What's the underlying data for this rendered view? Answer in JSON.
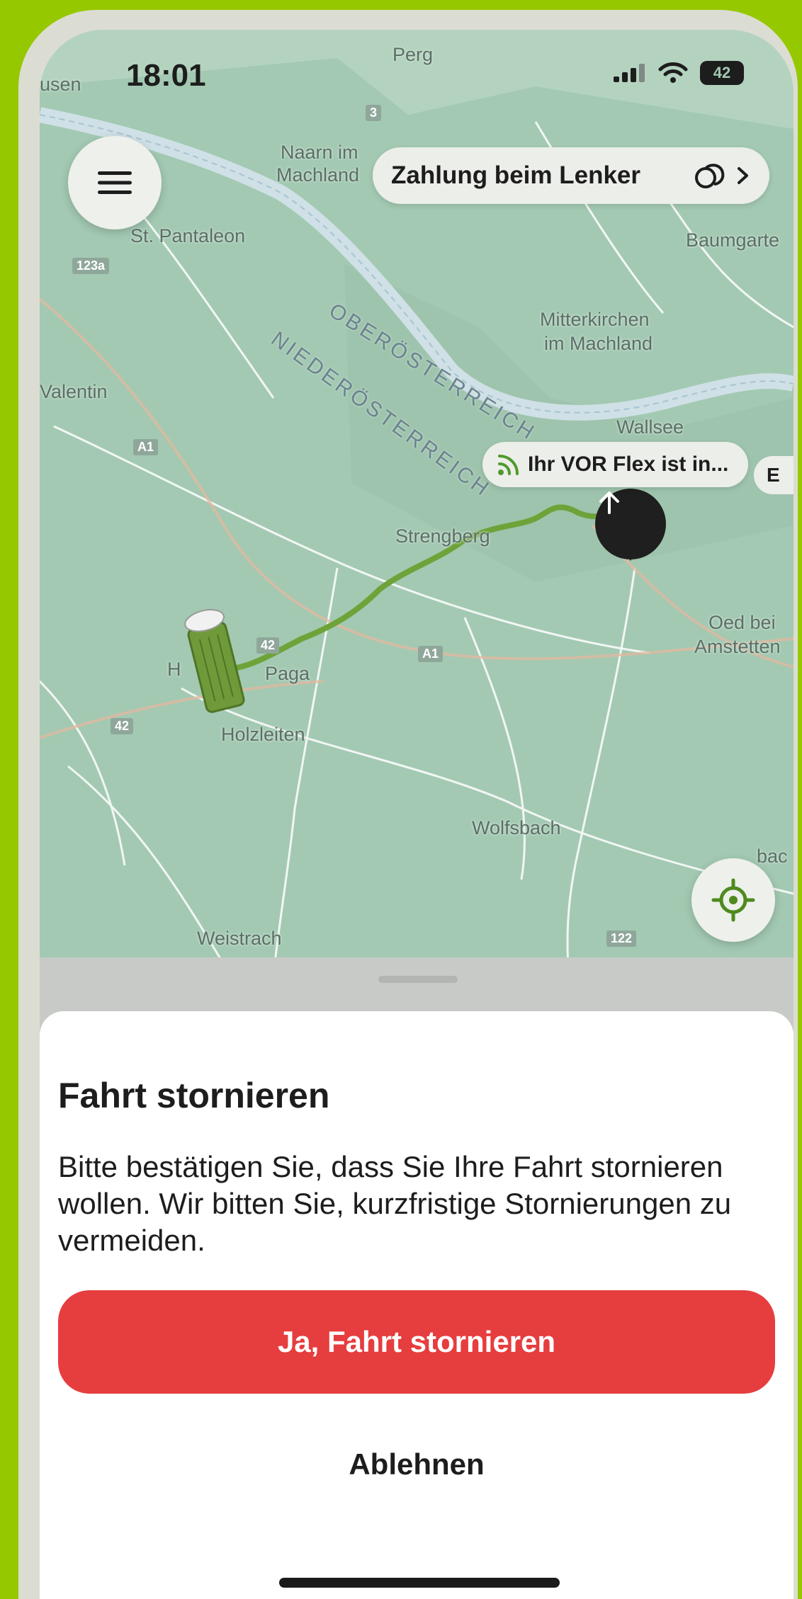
{
  "status_bar": {
    "time": "18:01",
    "battery": "42"
  },
  "map": {
    "places": [
      "Perg",
      "Naarn im",
      "Machland",
      "St. Pantaleon",
      "Baumgarte",
      "Mitterkirchen",
      "im Machland",
      "Valentin",
      "Wallsee",
      "Strengberg",
      "Oed bei",
      "Amstetten",
      "Paga",
      "Holzleiten",
      "Wolfsbach",
      "Weistrach",
      "usen",
      "H",
      "bac"
    ],
    "regions": [
      "OBERÖSTERREICH",
      "NIEDERÖSTERREICH"
    ],
    "road_shields": [
      "3",
      "123a",
      "A1",
      "42",
      "A1",
      "42",
      "122"
    ]
  },
  "payment_chip": {
    "label": "Zahlung beim Lenker",
    "icon": "coins-icon"
  },
  "eta_chip": {
    "label": "Ihr VOR Flex ist in...",
    "next_fragment": "E"
  },
  "colors": {
    "accent_red": "#e63d3f",
    "route_green": "#6ea339",
    "frame_green": "#96c800"
  },
  "dialog": {
    "title": "Fahrt stornieren",
    "text": "Bitte bestätigen Sie, dass Sie Ihre Fahrt stornieren wollen. Wir bitten Sie, kurzfristige Stornierungen zu vermeiden.",
    "confirm_label": "Ja, Fahrt stornieren",
    "decline_label": "Ablehnen"
  }
}
